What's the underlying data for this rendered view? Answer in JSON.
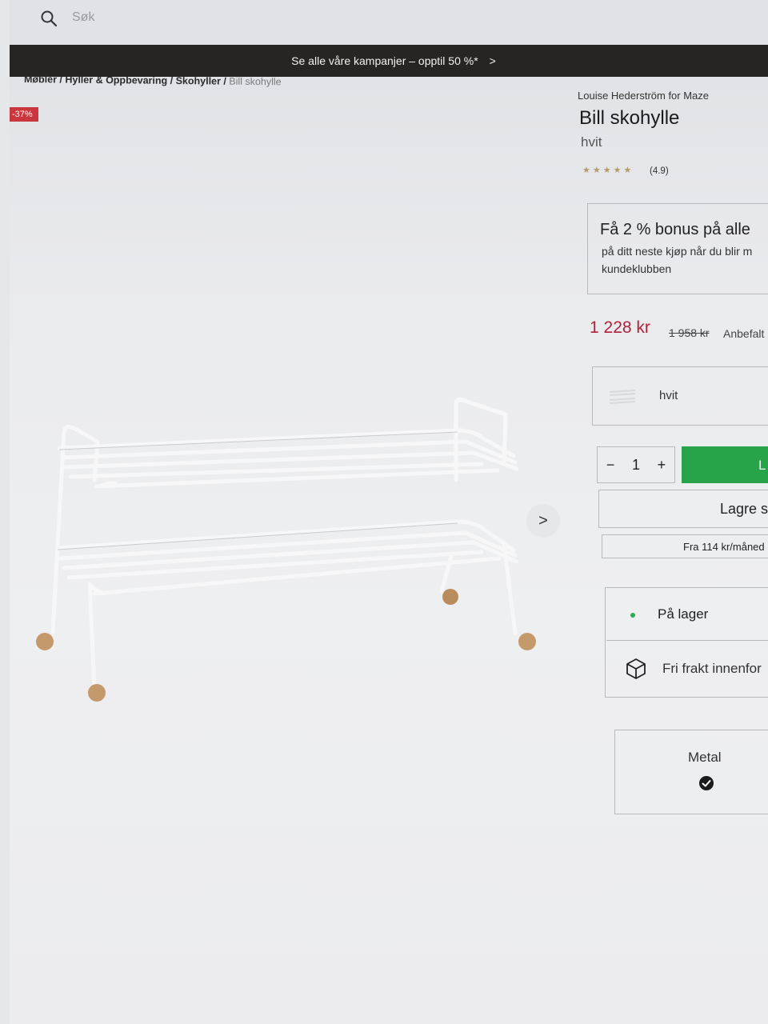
{
  "search": {
    "placeholder": "Søk"
  },
  "promo": {
    "text": "Se alle våre kampanjer – opptil 50 %*"
  },
  "breadcrumb": {
    "items": [
      "Møbler",
      "Hyller & Oppbevaring",
      "Skohyller"
    ],
    "current": "Bill skohylle"
  },
  "badge": {
    "discount": "-37%"
  },
  "product": {
    "brand": "Louise Hederström for Maze",
    "title": "Bill skohylle",
    "variant": "hvit",
    "stars": "★★★★★",
    "rating": "(4.9)"
  },
  "bonus": {
    "title": "Få 2 % bonus på alle",
    "line1": "på ditt neste kjøp når du blir m",
    "line2": "kundeklubben"
  },
  "price": {
    "current": "1 228 kr",
    "old": "1 958 kr",
    "recommended": "Anbefalt"
  },
  "color": {
    "label": "hvit"
  },
  "quantity": {
    "minus": "−",
    "value": "1",
    "plus": "+"
  },
  "buy": {
    "label": "L"
  },
  "save": {
    "label": "Lagre s"
  },
  "finance": {
    "label": "Fra 114 kr/måned"
  },
  "stock": {
    "label": "På lager"
  },
  "freight": {
    "label": "Fri frakt innenfor"
  },
  "material": {
    "label": "Metal"
  },
  "colors": {
    "accent_green": "#27a349",
    "price_red": "#b1223a",
    "badge_red": "#c9363e",
    "promo_bg": "#272424"
  }
}
